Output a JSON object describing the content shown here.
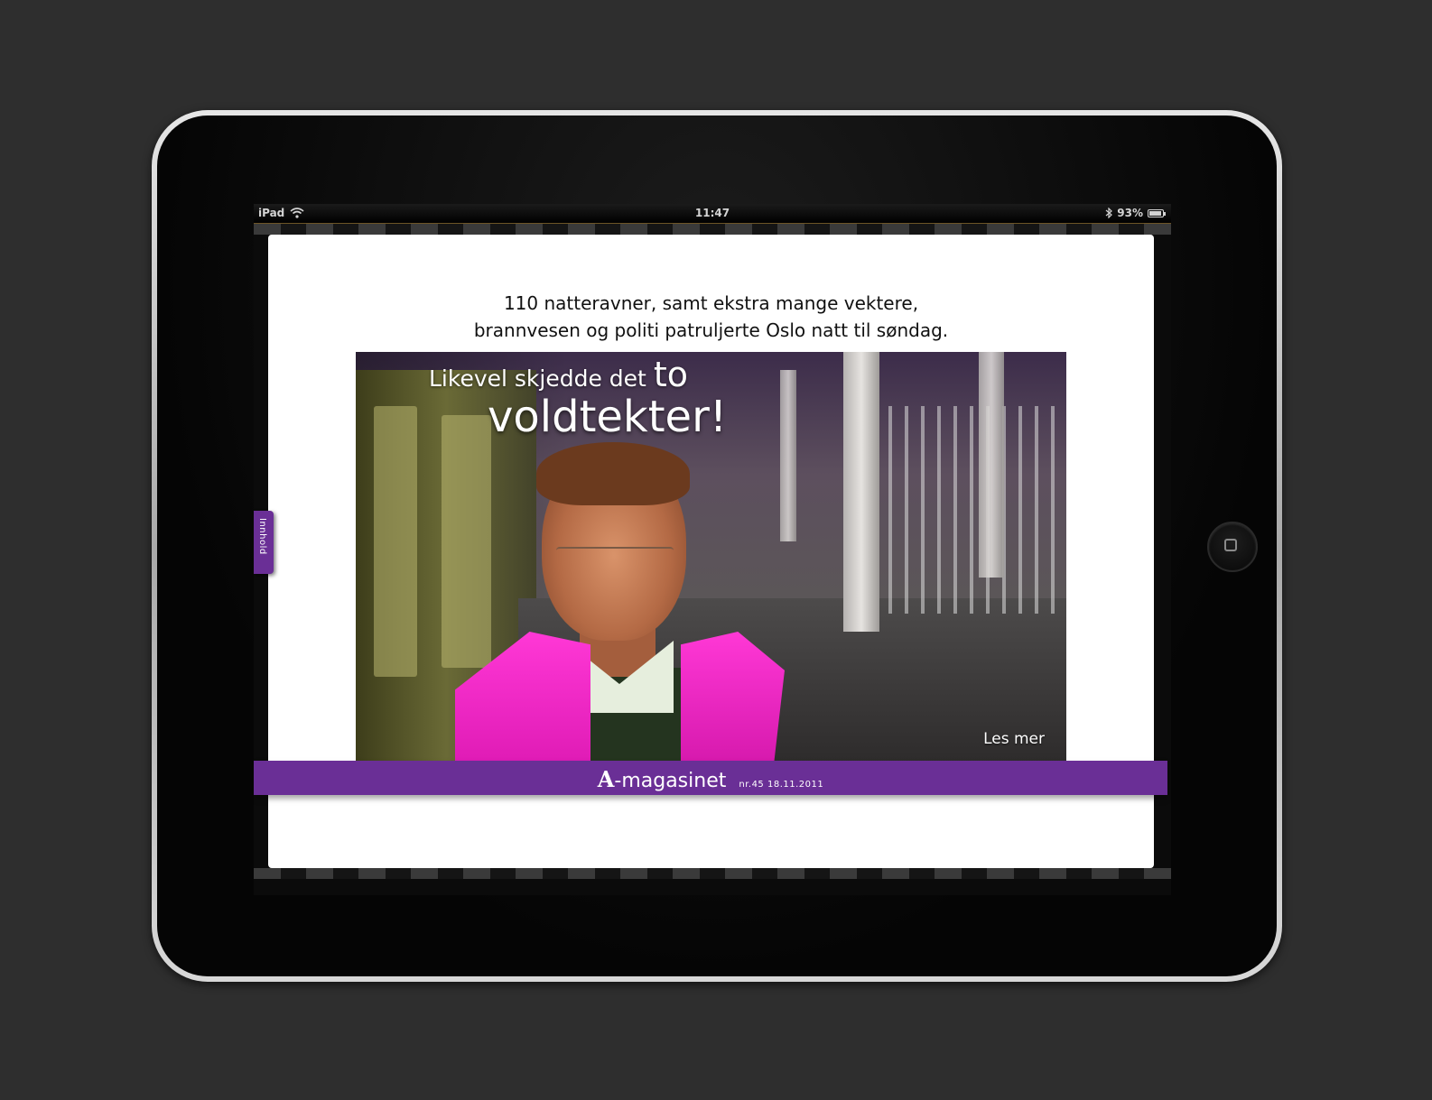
{
  "device": {
    "name": "iPad",
    "home_button_icon": "home-square-icon"
  },
  "status_bar": {
    "carrier": "iPad",
    "wifi_icon": "wifi-icon",
    "time": "11:47",
    "bluetooth_icon": "bluetooth-icon",
    "battery_percent_label": "93%",
    "battery_level": 0.93
  },
  "article": {
    "intro_line_1": "110 natteravner, samt ekstra mange vektere,",
    "intro_line_2": "brannvesen og politi patruljerte Oslo natt til søndag.",
    "headline_part_1": "Likevel skjedde det ",
    "headline_emphasis": "to",
    "headline_part_2": "voldtekter!",
    "read_more_label": "Les mer"
  },
  "footer": {
    "logo_letter": "A",
    "logo_text": "-magasinet",
    "issue": "nr.45  18.11.2011"
  },
  "side_tab": {
    "label": "Innhold"
  },
  "colors": {
    "background": "#2e2e2e",
    "brand_purple": "#6a2f96",
    "vest_pink": "#ff38d6"
  }
}
